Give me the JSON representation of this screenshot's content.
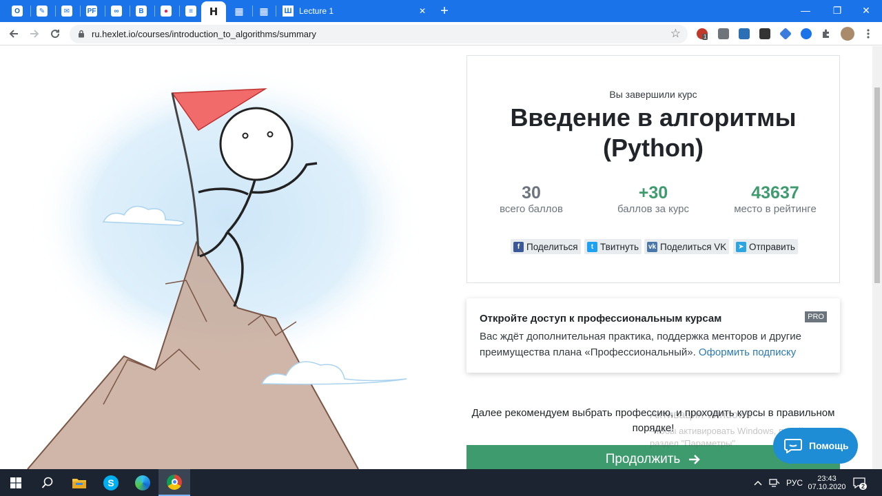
{
  "browser": {
    "tabs": [
      {
        "icon": "outlook-icon",
        "color": "#0f5ea8",
        "glyph": "O"
      },
      {
        "icon": "leaf-icon",
        "color": "#1a73e8",
        "glyph": "✎"
      },
      {
        "icon": "mail-icon",
        "color": "#1a73e8",
        "glyph": "✉"
      },
      {
        "icon": "pf-icon",
        "color": "#1a73e8",
        "glyph": "PF"
      },
      {
        "icon": "link-icon",
        "color": "#1a73e8",
        "glyph": "∞"
      },
      {
        "icon": "b-icon",
        "color": "#1a73e8",
        "glyph": "B"
      },
      {
        "icon": "pin-icon",
        "color": "#e2245a",
        "glyph": "●"
      },
      {
        "icon": "docs-icon",
        "color": "#1a73e8",
        "glyph": "≡"
      }
    ],
    "active_tab_glyph": "Н",
    "lecture_tab": {
      "title": "Lecture 1",
      "close": "✕"
    },
    "new_tab": "+",
    "window_controls": {
      "minimize": "—",
      "maximize": "❐",
      "close": "✕"
    },
    "url": "ru.hexlet.io/courses/introduction_to_algorithms/summary",
    "extension_badge": "1"
  },
  "summary": {
    "subtitle": "Вы завершили курс",
    "course_title": "Введение в алгоритмы (Python)",
    "stats": [
      {
        "value": "30",
        "label": "всего баллов",
        "color": "#6c757d"
      },
      {
        "value": "+30",
        "label": "баллов за курс",
        "color": "#3e9b6e"
      },
      {
        "value": "43637",
        "label": "место в рейтинге",
        "color": "#3e9b6e"
      }
    ],
    "share_buttons": [
      {
        "label": "Поделиться",
        "icon": "facebook-icon",
        "color": "#3b5998",
        "glyph": "f"
      },
      {
        "label": "Твитнуть",
        "icon": "twitter-icon",
        "color": "#1da1f2",
        "glyph": "t"
      },
      {
        "label": "Поделиться VK",
        "icon": "vk-icon",
        "color": "#4a76a8",
        "glyph": "vk"
      },
      {
        "label": "Отправить",
        "icon": "telegram-icon",
        "color": "#2ca5e0",
        "glyph": "➤"
      }
    ]
  },
  "pro": {
    "title": "Откройте доступ к профессиональным курсам",
    "badge": "PRO",
    "text": "Вас ждёт дополнительная практика, поддержка менторов и другие преимущества плана «Профессиональный».",
    "link": "Оформить подписку"
  },
  "recommend_text": "Далее рекомендуем выбрать профессию, и проходить курсы в правильном порядке!",
  "continue_label": "Продолжить",
  "help_label": "Помощь",
  "watermark": {
    "title": "Активация Windows",
    "text": "Чтобы активировать Windows, перейдите в раздел \"Параметры\"."
  },
  "taskbar": {
    "lang": "РУС",
    "time": "23:43",
    "date": "07.10.2020",
    "notifications": "2"
  }
}
